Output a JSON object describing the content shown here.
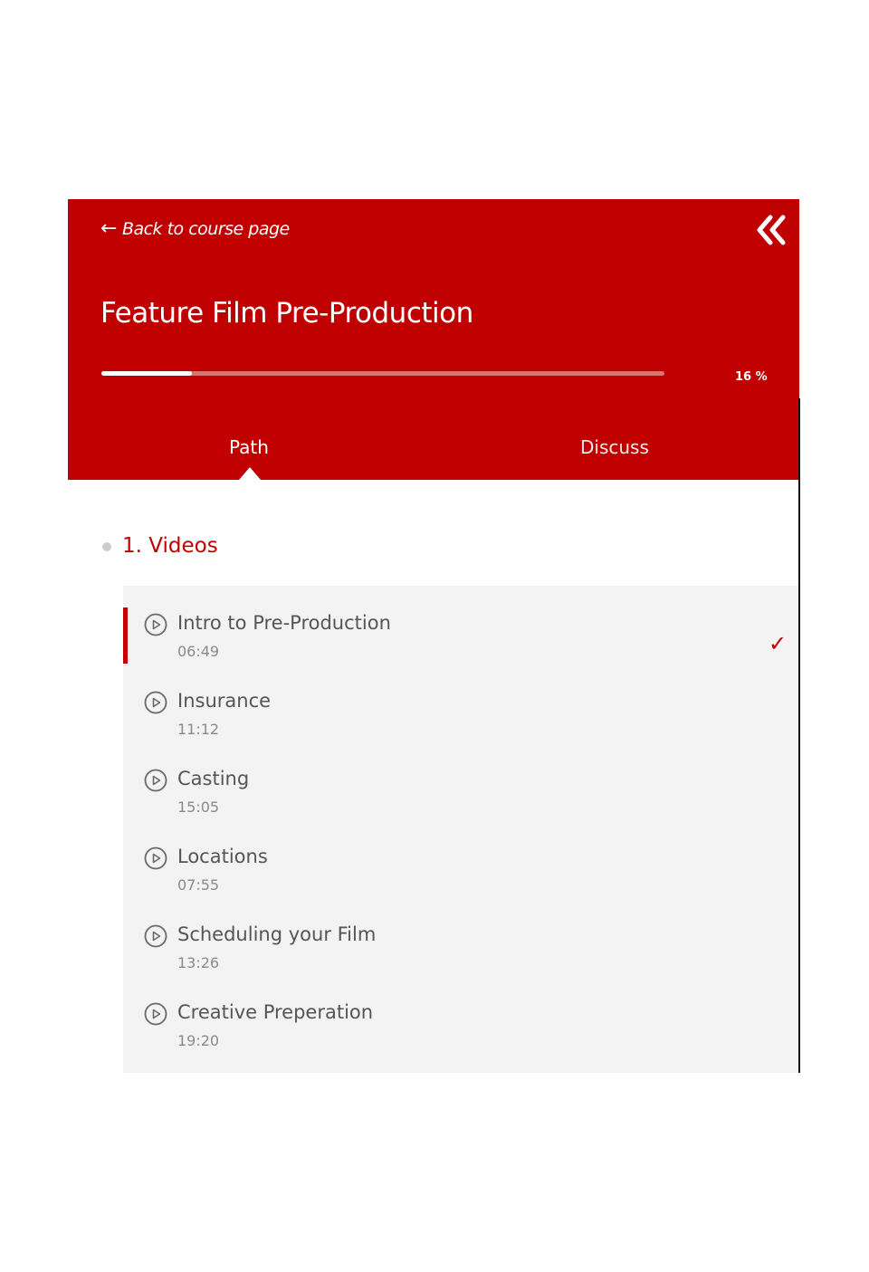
{
  "header": {
    "back_label": "Back to course page",
    "course_title": "Feature Film Pre-Production",
    "progress_percent": 16,
    "progress_label": "16 %",
    "tabs": [
      {
        "label": "Path",
        "active": true
      },
      {
        "label": "Discuss",
        "active": false
      }
    ]
  },
  "section": {
    "title": "1. Videos"
  },
  "lessons": [
    {
      "title": "Intro to Pre-Production",
      "duration": "06:49",
      "active": true,
      "completed": true
    },
    {
      "title": "Insurance",
      "duration": "11:12",
      "active": false,
      "completed": false
    },
    {
      "title": "Casting",
      "duration": "15:05",
      "active": false,
      "completed": false
    },
    {
      "title": "Locations",
      "duration": "07:55",
      "active": false,
      "completed": false
    },
    {
      "title": "Scheduling your Film",
      "duration": "13:26",
      "active": false,
      "completed": false
    },
    {
      "title": "Creative Preperation",
      "duration": "19:20",
      "active": false,
      "completed": false
    }
  ],
  "icons": {
    "back": "arrow-left-icon",
    "collapse": "double-chevron-left-icon",
    "lesson": "play-circle-icon",
    "completed": "checkmark-icon"
  },
  "colors": {
    "brand": "#c00000",
    "lesson_background": "#f3f3f3",
    "text_muted": "#8a8a8a"
  }
}
